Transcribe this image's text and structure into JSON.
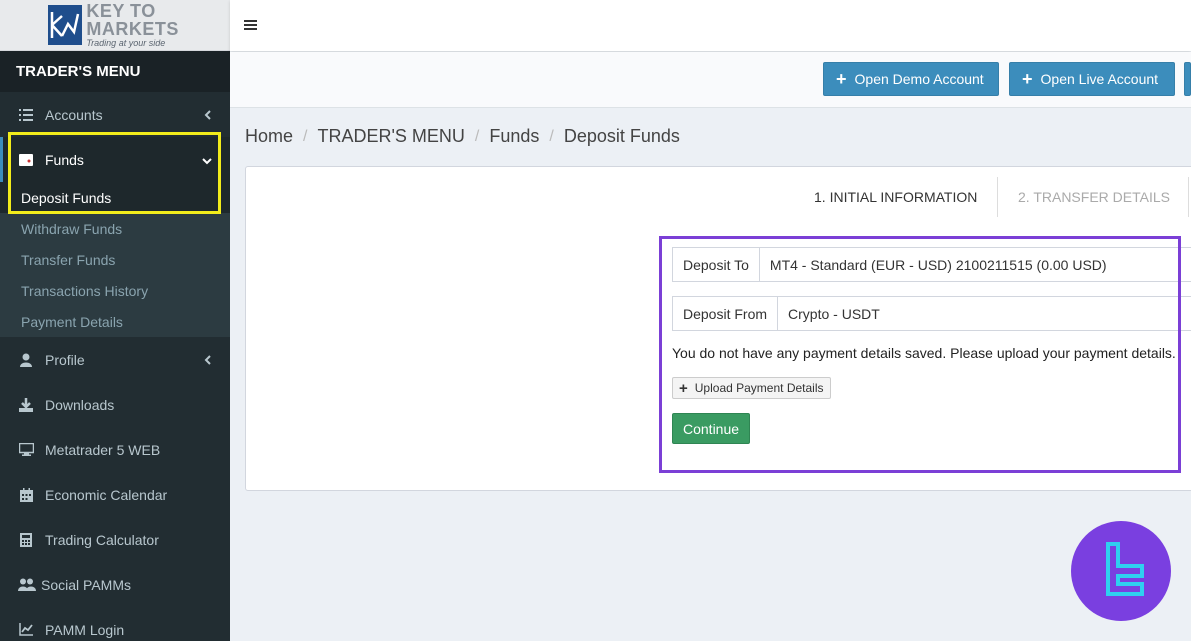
{
  "brand": {
    "name": "KEY TO MARKETS",
    "tagline": "Trading at your side"
  },
  "sidebar": {
    "header": "TRADER'S MENU",
    "items": [
      {
        "label": "Accounts",
        "icon": "list-icon"
      },
      {
        "label": "Funds",
        "icon": "wallet-icon"
      },
      {
        "label": "Profile",
        "icon": "user-icon"
      },
      {
        "label": "Downloads",
        "icon": "download-icon"
      },
      {
        "label": "Metatrader 5 WEB",
        "icon": "monitor-icon"
      },
      {
        "label": "Economic Calendar",
        "icon": "calendar-icon"
      },
      {
        "label": "Trading Calculator",
        "icon": "calculator-icon"
      },
      {
        "label": "Social PAMMs",
        "icon": "users-icon"
      },
      {
        "label": "PAMM Login",
        "icon": "chart-icon"
      }
    ],
    "funds_submenu": [
      "Deposit Funds",
      "Withdraw Funds",
      "Transfer Funds",
      "Transactions History",
      "Payment Details"
    ]
  },
  "actions": {
    "open_demo": "Open Demo Account",
    "open_live": "Open Live Account"
  },
  "breadcrumb": [
    "Home",
    "TRADER'S MENU",
    "Funds",
    "Deposit Funds"
  ],
  "steps": {
    "step1": "1. INITIAL INFORMATION",
    "step2": "2. TRANSFER DETAILS"
  },
  "form": {
    "deposit_to_label": "Deposit To",
    "deposit_to_value": "MT4 - Standard (EUR - USD) 2100211515 (0.00 USD)",
    "deposit_from_label": "Deposit From",
    "deposit_from_value": "Crypto - USDT",
    "notice": "You do not have any payment details saved. Please upload your payment details.",
    "upload_button": "Upload Payment Details",
    "continue_button": "Continue"
  },
  "colors": {
    "sidebar_bg": "#222d32",
    "primary": "#3c8dbc",
    "success": "#3a9b62",
    "highlight_yellow": "#f2ec1b",
    "highlight_purple": "#7b3fd6"
  }
}
